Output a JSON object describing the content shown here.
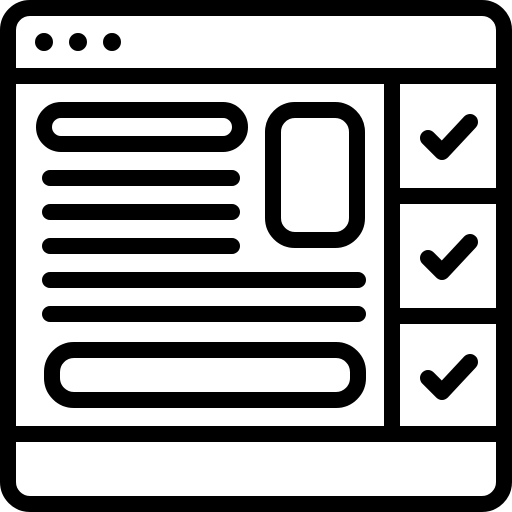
{
  "icon": {
    "name": "browser-checklist-icon",
    "stroke_color": "#000000",
    "fill_color": "#ffffff"
  },
  "window": {
    "title_bar_dots": 3
  },
  "checklist": {
    "items": [
      {
        "checked": true
      },
      {
        "checked": true
      },
      {
        "checked": true
      }
    ]
  }
}
